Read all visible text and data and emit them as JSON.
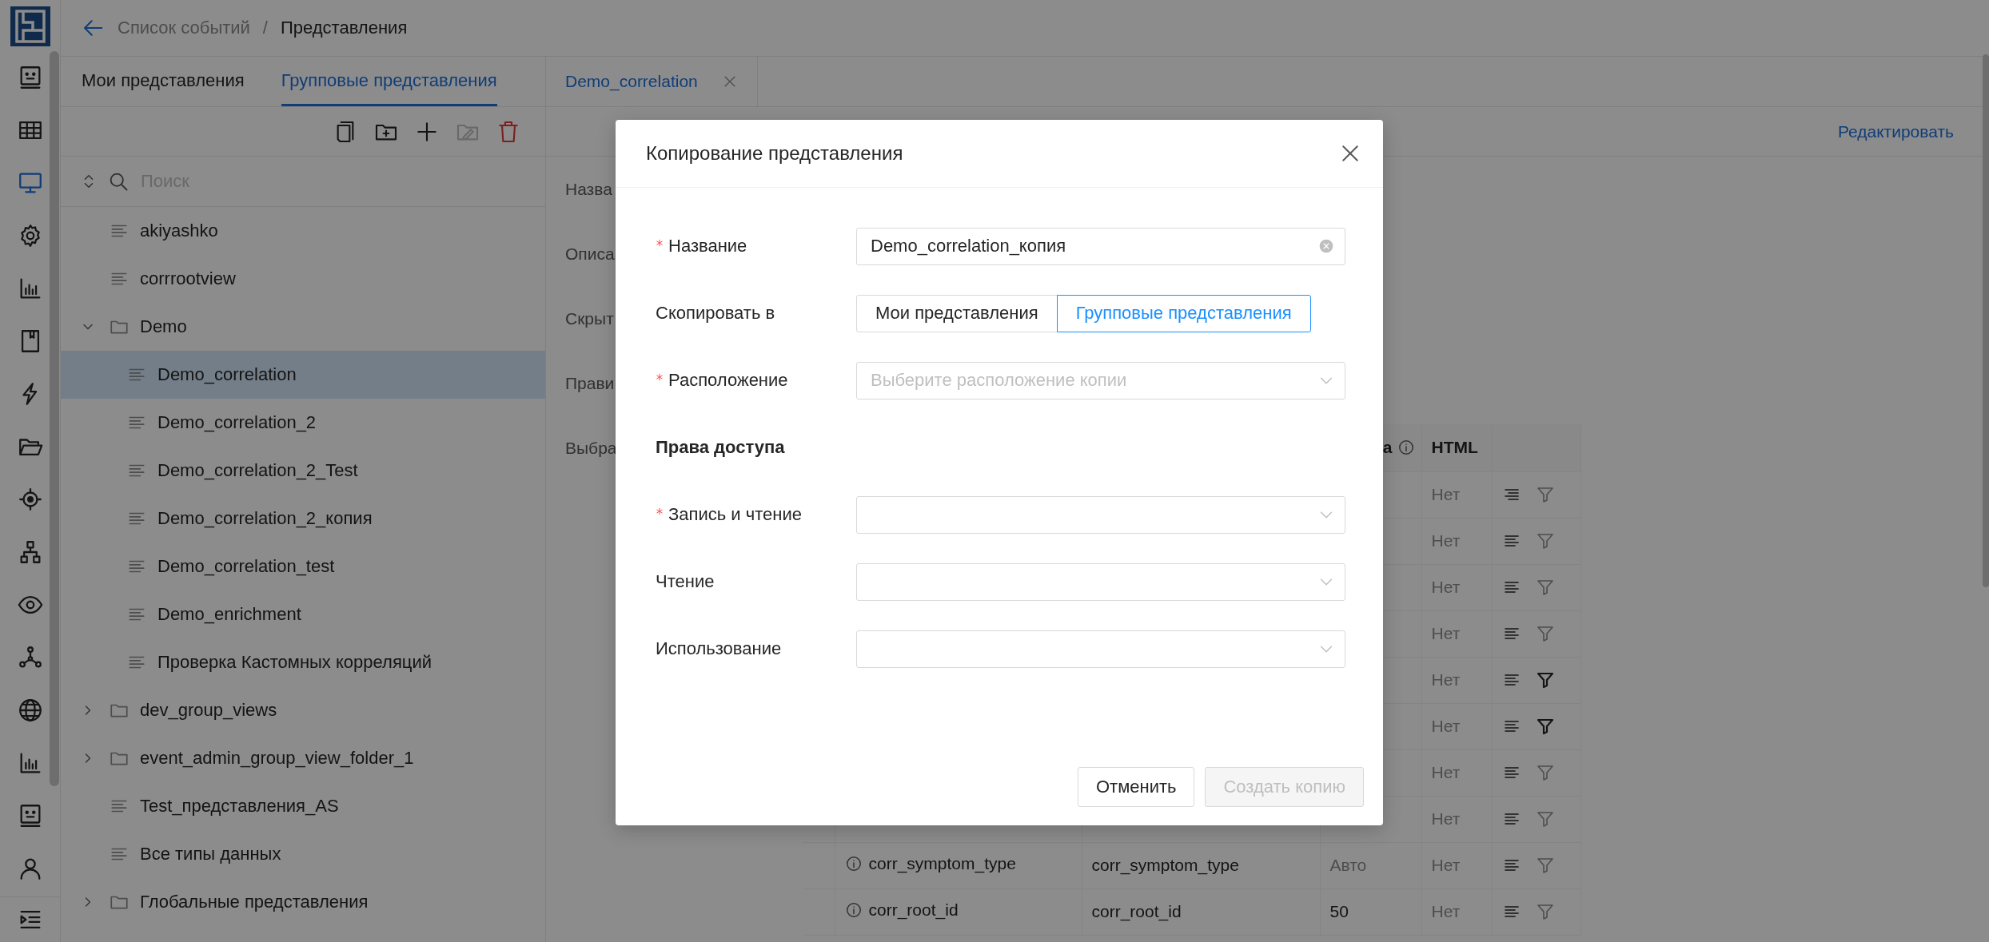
{
  "rail": [
    {
      "selected": false
    },
    {
      "selected": false
    },
    {
      "selected": true
    },
    {
      "selected": false
    },
    {
      "selected": false
    },
    {
      "selected": false
    },
    {
      "selected": false
    },
    {
      "selected": false
    },
    {
      "selected": false
    },
    {
      "selected": false
    },
    {
      "selected": false
    },
    {
      "selected": false
    },
    {
      "selected": false
    },
    {
      "selected": false
    },
    {
      "selected": false
    },
    {
      "selected": false
    }
  ],
  "breadcrumb": {
    "items": [
      {
        "label": "Список событий",
        "current": false
      },
      {
        "label": "Представления",
        "current": true
      }
    ],
    "separator": "/"
  },
  "left_panel": {
    "tabs": [
      {
        "label": "Мои представления",
        "selected": false
      },
      {
        "label": "Групповые представления",
        "selected": true
      }
    ],
    "toolbar": [
      {
        "kind": "copy",
        "disabled": false
      },
      {
        "kind": "folder-add",
        "disabled": false
      },
      {
        "kind": "plus",
        "disabled": false
      },
      {
        "kind": "folder-edit",
        "disabled": true
      },
      {
        "kind": "delete",
        "disabled": false
      }
    ],
    "search": {
      "placeholder": "Поиск"
    },
    "tree": [
      {
        "kind": "view",
        "label": "akiyashko",
        "selected": false
      },
      {
        "kind": "view",
        "label": "corrrootview",
        "selected": false
      },
      {
        "kind": "folder",
        "label": "Demo",
        "selected": false,
        "expanded": true,
        "children": [
          {
            "kind": "view",
            "label": "Demo_correlation",
            "selected": true
          },
          {
            "kind": "view",
            "label": "Demo_correlation_2",
            "selected": false
          },
          {
            "kind": "view",
            "label": "Demo_correlation_2_Test",
            "selected": false
          },
          {
            "kind": "view",
            "label": "Demo_correlation_2_копия",
            "selected": false
          },
          {
            "kind": "view",
            "label": "Demo_correlation_test",
            "selected": false
          },
          {
            "kind": "view",
            "label": "Demo_enrichment",
            "selected": false
          },
          {
            "kind": "view",
            "label": "Проверка Кастомных корреляций",
            "selected": false
          }
        ]
      },
      {
        "kind": "folder",
        "label": "dev_group_views",
        "selected": false,
        "expanded": false
      },
      {
        "kind": "folder",
        "label": "event_admin_group_view_folder_1",
        "selected": false,
        "expanded": false
      },
      {
        "kind": "view",
        "label": "Test_представления_AS",
        "selected": false
      },
      {
        "kind": "view",
        "label": "Все типы данных",
        "selected": false
      },
      {
        "kind": "folder",
        "label": "Глобальные представления",
        "selected": false,
        "expanded": false
      }
    ]
  },
  "main": {
    "tabs": [
      {
        "label": "Demo_correlation",
        "selected": true,
        "closable": true
      }
    ],
    "edit_link": "Редактировать",
    "form_labels": [
      "Назва",
      "Описа",
      "Скрыт",
      "Прави",
      "Выбра"
    ],
    "table": {
      "header": {
        "column_4": {
          "label": "а",
          "info": true
        },
        "html": "HTML"
      },
      "rows": [
        {
          "html": "Нет",
          "align_right": true,
          "filter_active": false
        },
        {
          "html": "Нет",
          "align_right": false,
          "filter_active": false
        },
        {
          "html": "Нет",
          "align_right": false,
          "filter_active": false
        },
        {
          "html": "Нет",
          "align_right": false,
          "filter_active": false
        },
        {
          "html": "Нет",
          "align_right": false,
          "filter_active": true
        },
        {
          "html": "Нет",
          "align_right": false,
          "filter_active": true
        },
        {
          "html": "Нет",
          "align_right": false,
          "filter_active": false
        },
        {
          "html": "Нет",
          "align_right": false,
          "filter_active": false
        },
        {
          "column_2": "corr_symptom_type",
          "column_3": "corr_symptom_type",
          "column_4": "Авто",
          "column_4_muted": true,
          "html": "Нет",
          "align_right": false,
          "filter_active": false
        },
        {
          "column_2": "corr_root_id",
          "column_3": "corr_root_id",
          "column_4": "50",
          "column_4_muted": false,
          "html": "Нет",
          "align_right": false,
          "filter_active": false
        }
      ]
    }
  },
  "modal": {
    "title": "Копирование представления",
    "fields": [
      {
        "kind": "input",
        "label": "Название",
        "required": true,
        "value": "Demo_correlation_копия",
        "clearable": true
      },
      {
        "kind": "segmented",
        "label": "Скопировать в",
        "required": false,
        "options": [
          {
            "label": "Мои представления",
            "selected": false
          },
          {
            "label": "Групповые представления",
            "selected": true
          }
        ]
      },
      {
        "kind": "select",
        "label": "Расположение",
        "required": true,
        "placeholder": "Выберите расположение копии"
      },
      {
        "kind": "section",
        "label": "Права доступа"
      },
      {
        "kind": "select",
        "label": "Запись и чтение",
        "required": true
      },
      {
        "kind": "select",
        "label": "Чтение",
        "required": false
      },
      {
        "kind": "select",
        "label": "Использование",
        "required": false
      }
    ],
    "buttons": [
      {
        "label": "Отменить",
        "kind": "default",
        "disabled": false
      },
      {
        "label": "Создать копию",
        "kind": "primary",
        "disabled": true
      }
    ]
  }
}
